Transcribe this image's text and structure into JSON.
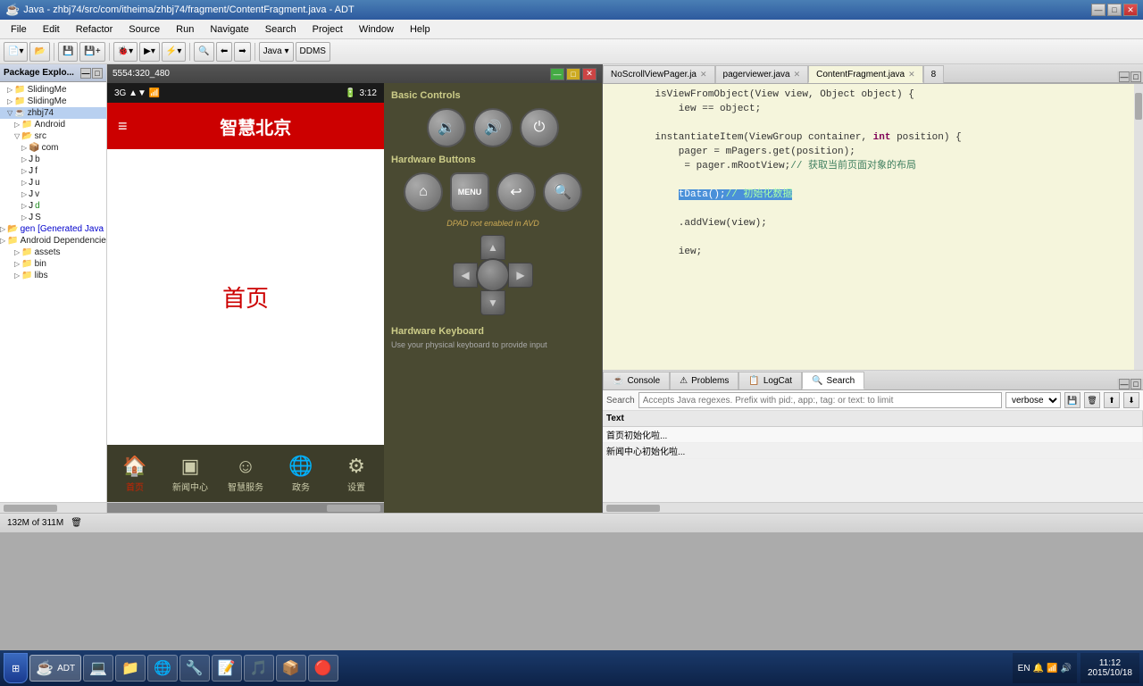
{
  "titleBar": {
    "title": "Java - zhbj74/src/com/itheima/zhbj74/fragment/ContentFragment.java - ADT",
    "controls": [
      "—",
      "□",
      "✕"
    ]
  },
  "menuBar": {
    "items": [
      "File",
      "Edit",
      "Refactor",
      "Source",
      "Run",
      "Navigate",
      "Search",
      "Project",
      "Window",
      "Help"
    ]
  },
  "emulator": {
    "title": "5554:320_480",
    "controls": [
      "—",
      "□",
      "✕"
    ],
    "statusBar": {
      "left": "3G",
      "time": "3:12"
    },
    "appBar": {
      "hamburger": "≡",
      "title": "智慧北京"
    },
    "content": "首页",
    "bottomNav": [
      {
        "icon": "🏠",
        "label": "首页",
        "active": true
      },
      {
        "icon": "📰",
        "label": "新闻中心",
        "active": false
      },
      {
        "icon": "☺",
        "label": "智慧服务",
        "active": false
      },
      {
        "icon": "🌐",
        "label": "政务",
        "active": false
      },
      {
        "icon": "⚙",
        "label": "设置",
        "active": false
      }
    ]
  },
  "hwControls": {
    "basicControlsTitle": "Basic Controls",
    "hwButtonsTitle": "Hardware Buttons",
    "dpadTitle": "DPAD not enabled in AVD",
    "hwKeyboardTitle": "Hardware Keyboard",
    "hwKeyboardSubtitle": "Use your physical keyboard to provide input",
    "buttons": {
      "volumeDown": "🔉",
      "volumeUp": "🔊",
      "power": "⏻",
      "home": "⌂",
      "menu": "MENU",
      "back": "↩",
      "search": "🔍"
    }
  },
  "tabs": [
    {
      "label": "NoScrollViewPager.ja",
      "active": false,
      "closable": true
    },
    {
      "label": "pagerviewer.java",
      "active": false,
      "closable": true
    },
    {
      "label": "ContentFragment.java",
      "active": true,
      "closable": true
    },
    {
      "label": "8",
      "active": false,
      "closable": false
    }
  ],
  "code": {
    "lines": [
      {
        "num": "",
        "text": "isViewFromObject(View view, Object object) {"
      },
      {
        "num": "",
        "text": "    iew == object;"
      },
      {
        "num": "",
        "text": ""
      },
      {
        "num": "",
        "text": "    instantiateItem(ViewGroup container, int position) {"
      },
      {
        "num": "",
        "text": "        pager = mPagers.get(position);"
      },
      {
        "num": "",
        "text": "         = pager.mRootView;// 获取当前页面对象的布局"
      },
      {
        "num": "",
        "text": ""
      },
      {
        "num": "",
        "text": "        tData();// 初始化数据",
        "highlight": true
      },
      {
        "num": "",
        "text": ""
      },
      {
        "num": "",
        "text": "        .addView(view);"
      },
      {
        "num": "",
        "text": ""
      },
      {
        "num": "",
        "text": "        iew;"
      }
    ]
  },
  "bottomPanel": {
    "tabs": [
      {
        "label": "☕ Console",
        "active": false
      },
      {
        "label": "⚠ Problems",
        "active": false
      },
      {
        "label": "📋 Logcat",
        "active": false
      },
      {
        "label": "🔍 Search",
        "active": true
      }
    ],
    "searchText": "Search",
    "filterPlaceholder": "Accepts Java regexes. Prefix with pid:, app:, tag: or text: to limit",
    "verboseOptions": [
      "verbose"
    ],
    "tableHeaders": [
      "Text"
    ],
    "rows": [
      {
        "text": "首页初始化啦..."
      },
      {
        "text": "新闻中心初始化啦..."
      }
    ]
  },
  "statusBar": {
    "memory": "132M of 311M",
    "icon": "🗑"
  },
  "taskbar": {
    "startLabel": "Start",
    "programs": [
      {
        "icon": "🖥",
        "label": "ADT",
        "active": true
      },
      {
        "icon": "💻",
        "label": "",
        "active": false
      },
      {
        "icon": "📁",
        "label": "",
        "active": false
      },
      {
        "icon": "🌐",
        "label": "",
        "active": false
      },
      {
        "icon": "🔧",
        "label": "",
        "active": false
      },
      {
        "icon": "📝",
        "label": "",
        "active": false
      },
      {
        "icon": "🎵",
        "label": "",
        "active": false
      },
      {
        "icon": "📦",
        "label": "",
        "active": false
      },
      {
        "icon": "🔴",
        "label": "",
        "active": false
      }
    ],
    "clock": {
      "time": "11:12",
      "date": "2015/10/18"
    },
    "lang": "EN"
  }
}
